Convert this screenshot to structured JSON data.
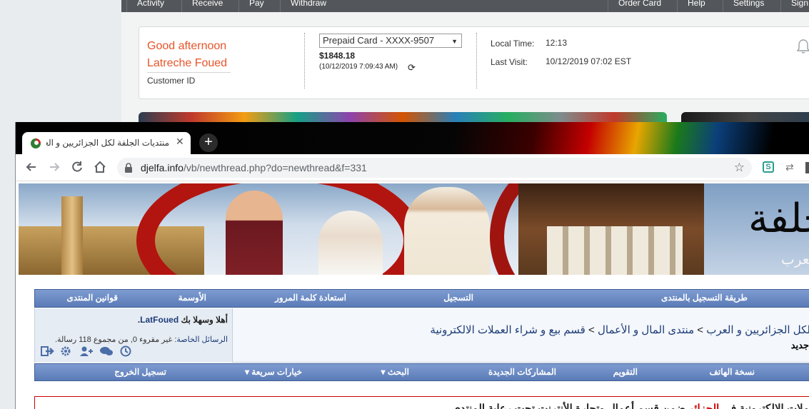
{
  "background_page": {
    "nav_items": [
      "Activity",
      "Receive",
      "Pay",
      "Withdraw",
      "Order Card",
      "Help",
      "Settings",
      "Sign"
    ],
    "greeting_line1": "Good afternoon",
    "greeting_name": "Latreche Foued",
    "customer_id_label": "Customer ID",
    "card_select_value": "Prepaid Card - XXXX-9507",
    "balance": "$1848.18",
    "balance_timestamp": "(10/12/2019 7:09:43 AM)",
    "local_time_label": "Local Time:",
    "local_time_value": "12:13",
    "last_visit_label": "Last Visit:",
    "last_visit_value": "10/12/2019 07:02 EST",
    "accent_color": "#e8542a"
  },
  "browser": {
    "tab_title": "منتديات الجلفة لكل الجزائريين و العرب",
    "new_tab_label": "+",
    "url_host": "djelfa.info",
    "url_path": "/vb/newthread.php?do=newthread&f=331",
    "extension_label": "S"
  },
  "forum": {
    "logo_text": "الجلفة",
    "logo_subtext": "والعرب",
    "nav_top": [
      "طريقة التسجيل بالمنتدى",
      "التسجيل",
      "استعادة كلمة المرور",
      "الأوسمة",
      "قوانين المنتدى"
    ],
    "welcome_prefix": "أهلا وسهلا بك",
    "username": "LatFoued",
    "welcome_suffix": ".",
    "pm_link": "الرسائل الخاصة",
    "pm_status": ": غير مقروء 0, من مجموع 118 رسالة.",
    "breadcrumb_start": "لكل الجزائريين و العرب",
    "breadcrumb_sep": ">",
    "breadcrumb_mid": "منتدى المال و الأعمال",
    "breadcrumb_end": "قسم بيع و شراء العملات الالكترونية",
    "page_subtitle": "جديد",
    "nav_bottom": [
      "نسخة الهاتف",
      "التقويم",
      "المشاركات الجديدة",
      "البحث ▾",
      "خيارات سريعة ▾",
      "تسجيل الخروج"
    ],
    "notice_prefix": "ملات الالكترونية في",
    "notice_red": "الجزائر",
    "notice_rest": " ضمن قسم أعمال وتجارة الأنترنت تحت رعاية المنتدى"
  }
}
